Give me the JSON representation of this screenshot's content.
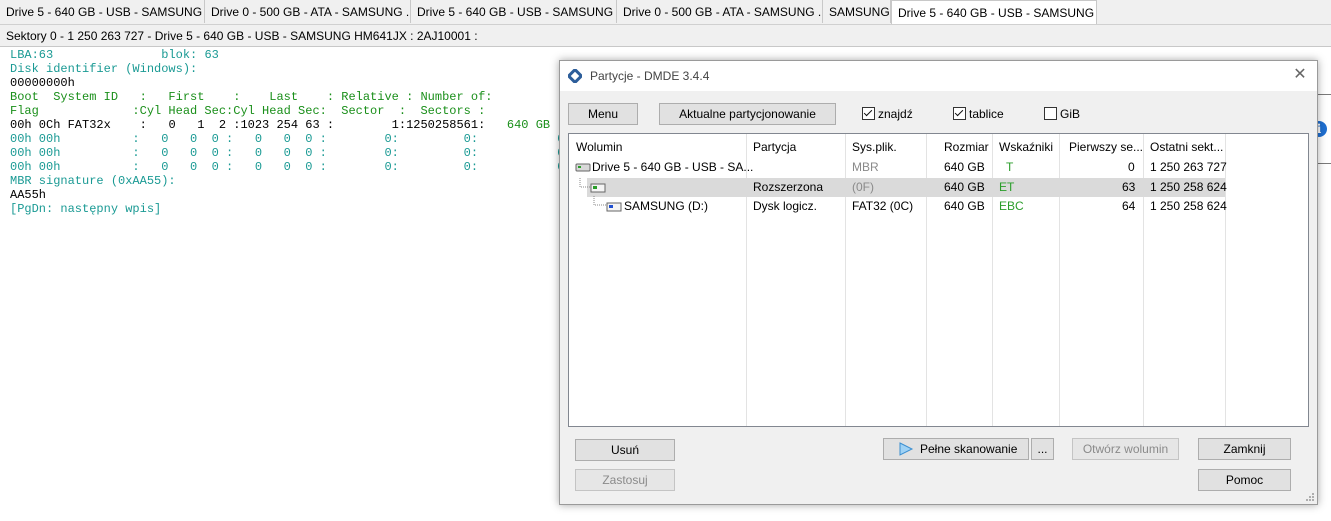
{
  "tabs": [
    {
      "label": "Drive 5 - 640 GB - USB - SAMSUNG ..."
    },
    {
      "label": "Drive 0 - 500 GB - ATA - SAMSUNG ..."
    },
    {
      "label": "Drive 5 - 640 GB - USB - SAMSUNG ..."
    },
    {
      "label": "Drive 0 - 500 GB - ATA - SAMSUNG ..."
    },
    {
      "label": "SAMSUNG"
    },
    {
      "label": "Drive 5 - 640 GB - USB - SAMSUNG ..."
    }
  ],
  "sectors_bar": "Sektory 0 - 1 250 263 727 - Drive 5 - 640 GB - USB - SAMSUNG HM641JX : 2AJ10001 :",
  "sector_view": {
    "lba": "LBA:63",
    "blok": "blok: 63",
    "disk_id_label": "Disk identifier (Windows):",
    "disk_id_value": "00000000h",
    "hdr1": "Boot  System ID   :   First    :    Last    : Relative : Number of:",
    "hdr2": "Flag             :Cyl Head Sec:Cyl Head Sec:  Sector  :  Sectors :",
    "row0_prefix": "00h 0Ch FAT32x",
    "row0_rest": "    :   0   1  2 :1023 254 63 :        1:1250258561:",
    "row0_size": "640 GB",
    "row1": "00h 00h          :   0   0  0 :   0   0  0 :        0:         0:           0",
    "row2": "00h 00h          :   0   0  0 :   0   0  0 :        0:         0:           0",
    "row3": "00h 00h          :   0   0  0 :   0   0  0 :        0:         0:           0",
    "mbr_label": "MBR signature (0xAA55):",
    "mbr_value": "AA55h",
    "pgdn": "[PgDn: następny wpis]"
  },
  "dialog": {
    "title": "Partycje - DMDE 3.4.4",
    "close_glyph": "✕",
    "menu_btn": "Menu",
    "current_btn": "Aktualne partycjonowanie",
    "chk_znajdz": "znajdź",
    "chk_znajdz_on": true,
    "chk_tablice": "tablice",
    "chk_tablice_on": true,
    "chk_gib": "GiB",
    "chk_gib_on": false,
    "columns": [
      "Wolumin",
      "Partycja",
      "Sys.plik.",
      "Rozmiar",
      "Wskaźniki",
      "Pierwszy se...",
      "Ostatni sekt..."
    ],
    "rows": [
      {
        "wolumin": "Drive 5 - 640 GB - USB - SA...",
        "partycja": "",
        "sys": "MBR",
        "rozmiar": "640 GB",
        "wsk": "T",
        "pierwszy": "0",
        "ostatni": "1 250 263 727"
      },
      {
        "wolumin": "",
        "partycja": "Rozszerzona",
        "sys": "(0F)",
        "rozmiar": "640 GB",
        "wsk": "ET",
        "pierwszy": "63",
        "ostatni": "1 250 258 624"
      },
      {
        "wolumin": "SAMSUNG (D:)",
        "partycja": "Dysk logicz.",
        "sys": "FAT32 (0C)",
        "rozmiar": "640 GB",
        "wsk": "EBC",
        "pierwszy": "64",
        "ostatni": "1 250 258 624"
      }
    ],
    "btn_usun": "Usuń",
    "btn_zastosuj": "Zastosuj",
    "btn_pelne": "Pełne skanowanie",
    "btn_more": "...",
    "btn_otworz": "Otwórz wolumin",
    "btn_zamknij": "Zamknij",
    "btn_pomoc": "Pomoc"
  },
  "info_icon_glyph": "i",
  "colors": {
    "teal": "#1a9a94",
    "green": "#2a9d2a",
    "selection": "#dadada"
  }
}
